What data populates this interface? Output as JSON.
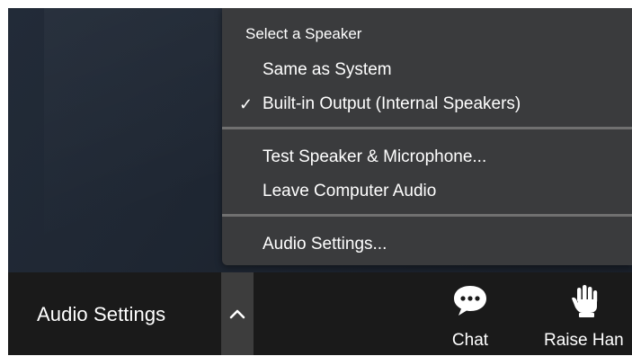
{
  "menu": {
    "header": "Select a Speaker",
    "items": [
      {
        "label": "Same as System",
        "checked": false
      },
      {
        "label": "Built-in Output (Internal Speakers)",
        "checked": true
      },
      {
        "label": "Test Speaker & Microphone..."
      },
      {
        "label": "Leave Computer Audio"
      },
      {
        "label": "Audio Settings..."
      }
    ],
    "check_glyph": "✓"
  },
  "toolbar": {
    "audio_settings_label": "Audio Settings",
    "chat_label": "Chat",
    "raise_hand_label": "Raise Han"
  },
  "icons": {
    "chevron": "chevron-up-icon",
    "chat": "chat-bubble-icon",
    "raise_hand": "raised-hand-icon",
    "check": "checkmark-icon"
  },
  "colors": {
    "menu_background": "#3a3b3d",
    "menu_divider": "#707070",
    "toolbar_background": "#1a1a1a",
    "chevron_button_background": "#3d3d3d",
    "video_background": "#1e2530",
    "text": "#ffffff"
  }
}
